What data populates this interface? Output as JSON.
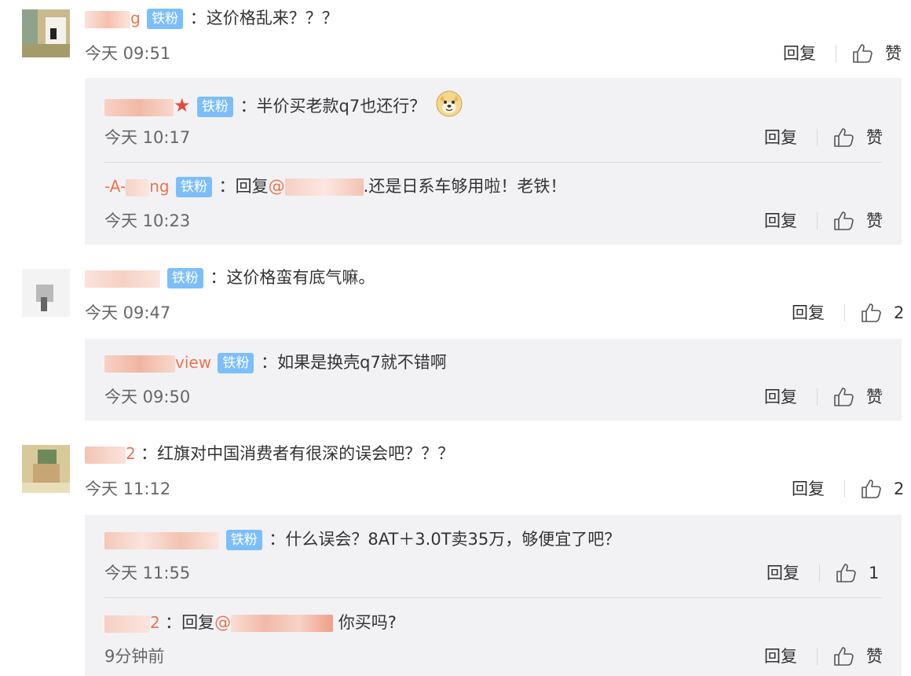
{
  "labels": {
    "badge": "铁粉",
    "reply": "回复",
    "like": "赞"
  },
  "comments": [
    {
      "username_tail": "g",
      "text": "：这价格乱来？？？",
      "time": "今天 09:51",
      "likes": "赞",
      "replies": [
        {
          "text": "：半价买老款q7也还行？",
          "time": "今天 10:17",
          "likes": "赞",
          "emoji": "doge-emoji"
        },
        {
          "username_prefix": "-A-",
          "username_tail": "ng",
          "text_prefix": "：回复",
          "mention_prefix": "@",
          "text": ".还是日系车够用啦！老铁！",
          "time": "今天 10:23",
          "likes": "赞"
        }
      ]
    },
    {
      "text": "：这价格蛮有底气嘛。",
      "time": "今天 09:47",
      "likes": "2",
      "replies": [
        {
          "username_tail": "view",
          "text": "：如果是换壳q7就不错啊",
          "time": "今天 09:50",
          "likes": "赞"
        }
      ]
    },
    {
      "username_tail": "2",
      "text": "：红旗对中国消费者有很深的误会吧？？？",
      "time": "今天 11:12",
      "likes": "2",
      "replies": [
        {
          "text": "：什么误会？8AT＋3.0T卖35万，够便宜了吧？",
          "time": "今天 11:55",
          "likes": "1"
        },
        {
          "username_tail": "2",
          "text_prefix": "：回复",
          "mention_prefix": "@",
          "text": "你买吗?",
          "time": "9分钟前",
          "likes": "赞"
        }
      ]
    }
  ],
  "colors": {
    "username": "#eb7350",
    "badge": "#7cbef9",
    "reply_bg": "#f2f2f5",
    "time": "#666666"
  }
}
